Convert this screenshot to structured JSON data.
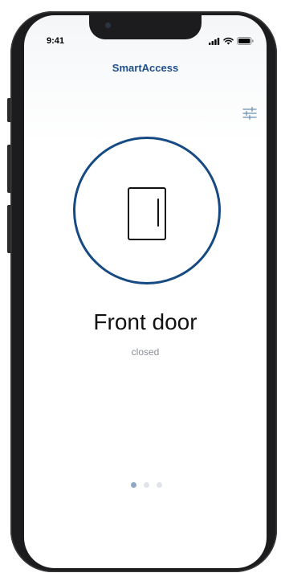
{
  "status_bar": {
    "time": "9:41",
    "signal_icon": "cellular-signal-icon",
    "wifi_icon": "wifi-icon",
    "battery_icon": "battery-icon"
  },
  "header": {
    "title": "SmartAccess",
    "settings_icon": "sliders-icon"
  },
  "door": {
    "name": "Front door",
    "status": "closed",
    "icon": "door-icon"
  },
  "pagination": {
    "total": 3,
    "active_index": 0
  },
  "colors": {
    "accent": "#164a83",
    "title": "#1f4e8a",
    "status_text": "#8a8f96",
    "dot_active": "#8ea8c4",
    "dot_inactive": "#e1e5ea"
  }
}
